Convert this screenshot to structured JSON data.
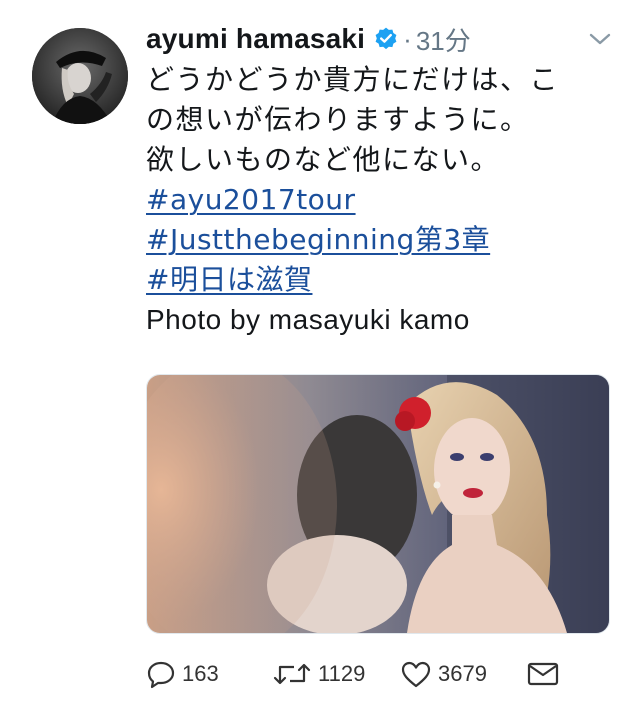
{
  "tweet": {
    "user_name": "ayumi hamasaki",
    "separator": "·",
    "time": "31分",
    "lines": [
      "どうかどうか貴方にだけは、こ",
      "の想いが伝わりますように。",
      "欲しいものなど他にない。"
    ],
    "hashtags": [
      "#ayu2017tour",
      "#Justthebeginning第3章",
      "#明日は滋賀"
    ],
    "credit": "Photo by masayuki kamo"
  },
  "actions": {
    "reply_count": "163",
    "retweet_count": "1129",
    "like_count": "3679"
  },
  "colors": {
    "link": "#1b4f9b",
    "verified": "#1da1f2",
    "muted": "#657786"
  },
  "icons": [
    "verified-badge-icon",
    "chevron-down-icon",
    "reply-icon",
    "retweet-icon",
    "like-icon",
    "direct-message-icon"
  ]
}
